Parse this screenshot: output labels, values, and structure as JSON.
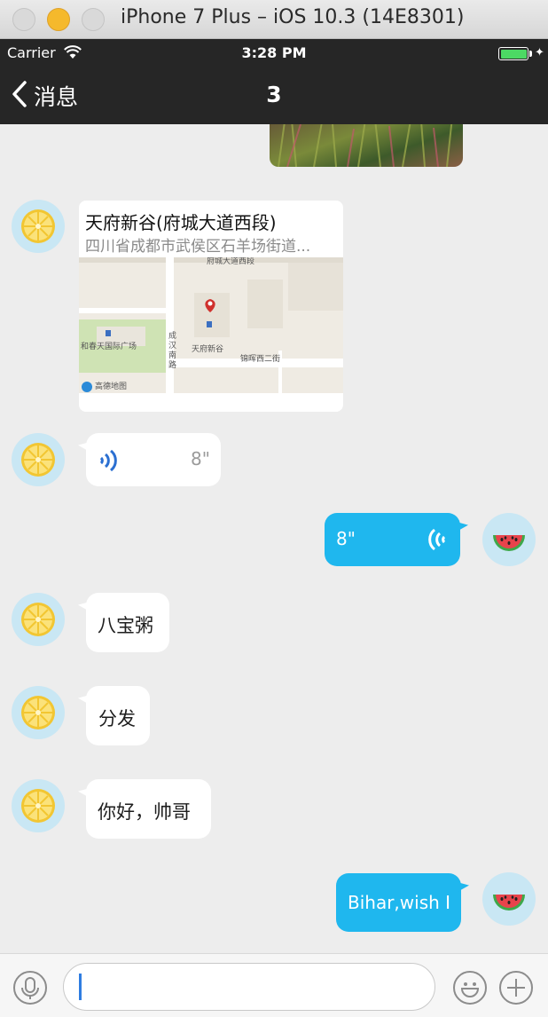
{
  "window": {
    "title": "iPhone 7 Plus – iOS 10.3 (14E8301)"
  },
  "status": {
    "carrier": "Carrier",
    "time": "3:28 PM"
  },
  "nav": {
    "back_label": "消息",
    "title": "3"
  },
  "messages": {
    "location": {
      "name": "天府新谷(府城大道西段)",
      "address": "四川省成都市武侯区石羊场街道...",
      "map_labels": {
        "street_top": "府城大道西段",
        "poi_left": "和春天国际广场",
        "poi_center": "天府新谷",
        "road_v": "成汉南路",
        "road_h": "锦晖西二街",
        "brand": "高德地图"
      }
    },
    "voice_in": {
      "duration": "8\""
    },
    "voice_out": {
      "duration": "8\""
    },
    "text1": "八宝粥",
    "text2": "分发",
    "text3": "你好，帅哥",
    "text_out": "Bihar,wish I"
  },
  "colors": {
    "outgoing": "#1fb7ee",
    "incoming": "#ffffff",
    "bar": "#262626",
    "voice_icon": "#2b6fd1"
  },
  "icons": {
    "incoming_avatar": "lemon-avatar",
    "outgoing_avatar": "watermelon-avatar"
  }
}
